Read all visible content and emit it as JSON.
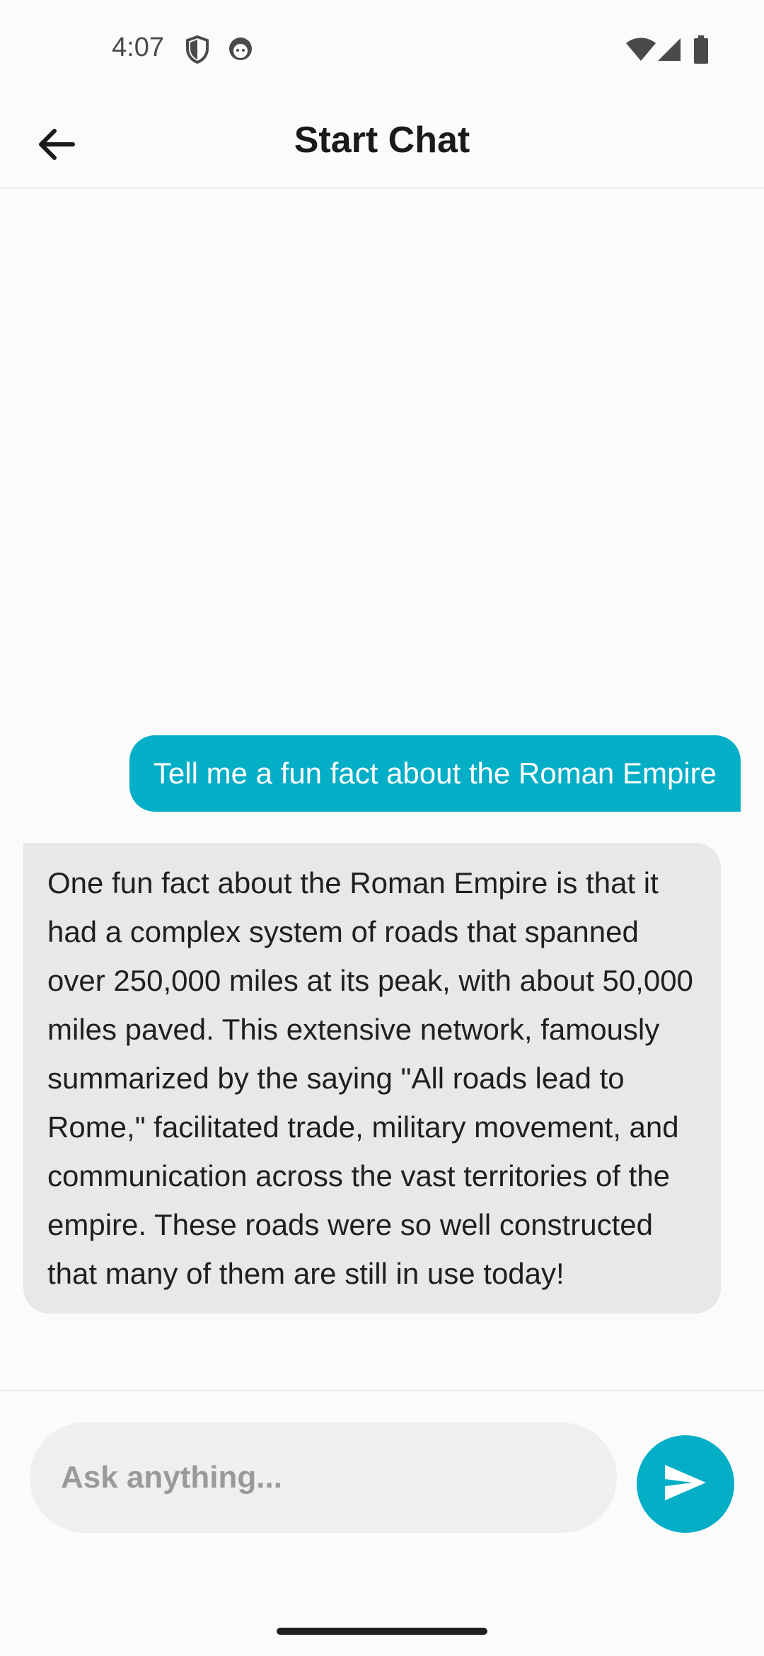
{
  "status_bar": {
    "time": "4:07",
    "icons_left": [
      "shield-icon",
      "face-icon"
    ],
    "icons_right": [
      "wifi-icon",
      "signal-icon",
      "battery-icon"
    ]
  },
  "header": {
    "title": "Start Chat",
    "back_icon": "arrow-left-icon"
  },
  "messages": [
    {
      "role": "user",
      "text": "Tell me a fun fact about the Roman Empire"
    },
    {
      "role": "assistant",
      "text": "One fun fact about the Roman Empire is that it had a complex system of roads that spanned over 250,000 miles at its peak, with about 50,000 miles paved. This extensive network, famously summarized by the saying \"All roads lead to Rome,\" facilitated trade, military movement, and communication across the vast territories of the empire. These roads were so well constructed that many of them are still in use today!"
    }
  ],
  "composer": {
    "placeholder": "Ask anything...",
    "value": "",
    "send_icon": "send-icon"
  },
  "colors": {
    "accent": "#05aec7",
    "bot_bubble": "#e8e8e8",
    "background": "#fbfbfb"
  }
}
